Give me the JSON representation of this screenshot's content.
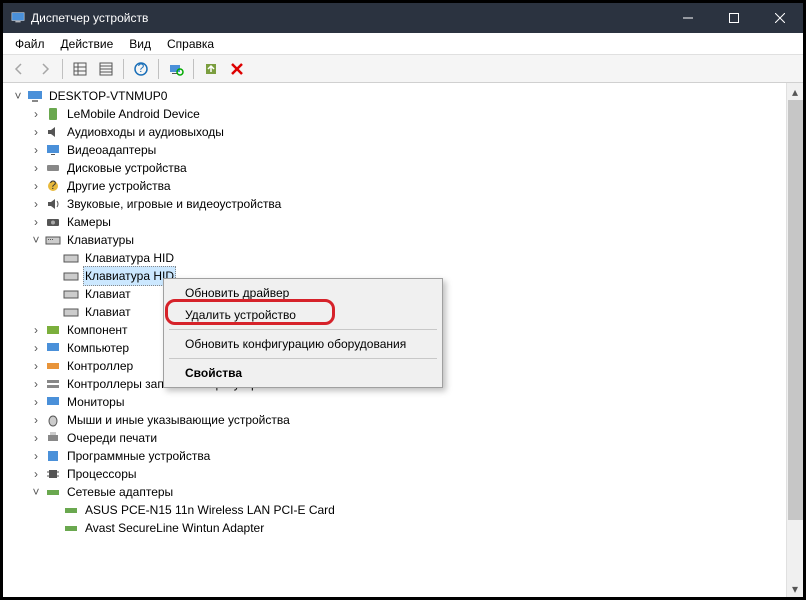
{
  "window": {
    "title": "Диспетчер устройств"
  },
  "menu": {
    "file": "Файл",
    "action": "Действие",
    "view": "Вид",
    "help": "Справка"
  },
  "root": {
    "name": "DESKTOP-VTNMUP0"
  },
  "cats": {
    "lemobile": "LeMobile Android Device",
    "audio": "Аудиовходы и аудиовыходы",
    "video": "Видеоадаптеры",
    "disk": "Дисковые устройства",
    "other": "Другие устройства",
    "sound": "Звуковые, игровые и видеоустройства",
    "cameras": "Камеры",
    "keyboards": "Клавиатуры",
    "components": "Компонент",
    "computer": "Компьютер",
    "controllers": "Контроллер",
    "storagectl": "Контроллеры запоминающих устройств",
    "monitors": "Мониторы",
    "mice": "Мыши и иные указывающие устройства",
    "printq": "Очереди печати",
    "software": "Программные устройства",
    "cpus": "Процессоры",
    "netadapters": "Сетевые адаптеры"
  },
  "kb": {
    "hid1": "Клавиатура HID",
    "hid2": "Клавиатура HID",
    "hid3": "Клавиат",
    "hid4": "Клавиат"
  },
  "net": {
    "asus": "ASUS PCE-N15 11n Wireless LAN PCI-E Card",
    "avast": "Avast SecureLine Wintun Adapter"
  },
  "ctx": {
    "update": "Обновить драйвер",
    "uninstall": "Удалить устройство",
    "scan": "Обновить конфигурацию оборудования",
    "props": "Свойства"
  }
}
